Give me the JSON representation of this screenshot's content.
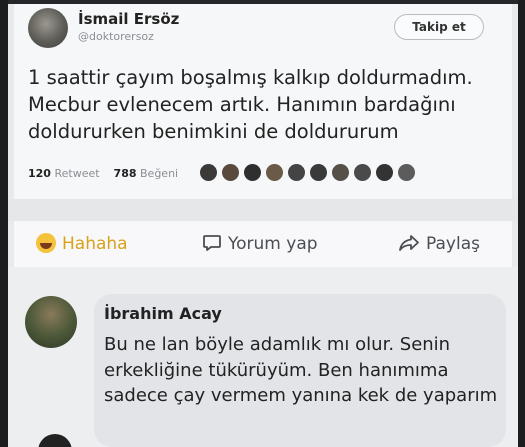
{
  "tweet": {
    "author_name": "İsmail Ersöz",
    "author_handle": "@doktorersoz",
    "follow_label": "Takip et",
    "text": "1 saattir çayım boşalmış kalkıp doldurmadım. Mecbur evlenecem artık. Hanımın bardağını doldururken benimkini de doldururum",
    "retweet_count": "120",
    "retweet_label": "Retweet",
    "like_count": "788",
    "like_label": "Beğeni",
    "likers": [
      "#3b3a38",
      "#5a4a3e",
      "#2f2f2f",
      "#6b5a48",
      "#444",
      "#3a3a3a",
      "#555048",
      "#4a4a4a",
      "#333",
      "#5c5c5c"
    ]
  },
  "actions": {
    "reaction_label": "Hahaha",
    "comment_label": "Yorum yap",
    "share_label": "Paylaş"
  },
  "comment": {
    "author_name": "İbrahim Acay",
    "text": "Bu ne lan böyle adamlık mı olur. Senin erkekliğine tükürüyüm. Ben hanımıma sadece çay vermem yanına kek de yaparım"
  },
  "colors": {
    "reaction_accent": "#d7a21a",
    "background": "#e9eaec"
  },
  "icons": [
    "haha-emoji-icon",
    "comment-icon",
    "share-icon"
  ]
}
